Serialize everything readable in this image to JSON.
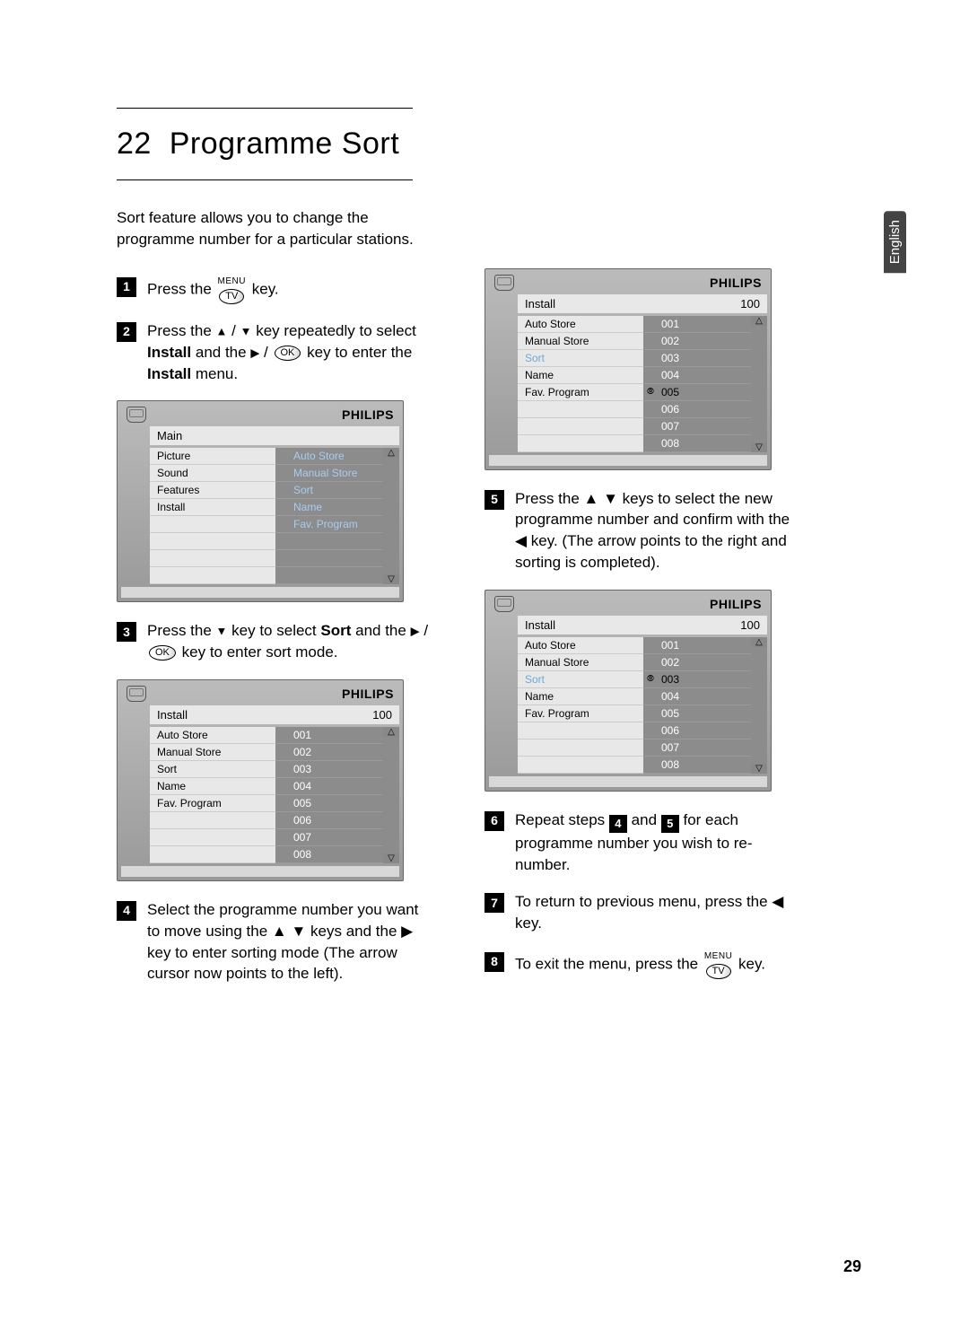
{
  "heading_num": "22",
  "heading_title": "Programme Sort",
  "intro": "Sort feature allows you to change the programme number for a particular stations.",
  "brand": "PHILIPS",
  "lang_tab": "English",
  "page_number": "29",
  "key_menu_label": "MENU",
  "key_tv_label": "TV",
  "key_ok_label": "OK",
  "steps": {
    "s1_a": "Press the",
    "s1_b": "key.",
    "s2_a": "Press the",
    "s2_b": "key repeatedly to select",
    "s2_bold1": "Install",
    "s2_c": "and the",
    "s2_d": "key to enter the",
    "s2_bold2": "Install",
    "s2_e": "menu.",
    "s3_a": "Press the",
    "s3_b": "key to select",
    "s3_bold": "Sort",
    "s3_c": "and the",
    "s3_d": "key to enter sort mode.",
    "s4": "Select the programme number you want to move using the ▲ ▼ keys and the ▶ key to enter sorting mode (The arrow cursor now points to the left).",
    "s5": "Press the ▲ ▼ keys to select the new programme number and confirm with the ◀ key. (The arrow points to the right and sorting is completed).",
    "s6_a": "Repeat steps",
    "s6_b": "and",
    "s6_c": "for each programme number you wish to re-number.",
    "s7": "To return to previous menu, press the ◀ key.",
    "s8_a": "To exit the menu, press the",
    "s8_b": "key."
  },
  "panel_main": {
    "title": "Main",
    "left": [
      "Picture",
      "Sound",
      "Features",
      "Install"
    ],
    "right": [
      "Auto Store",
      "Manual Store",
      "Sort",
      "Name",
      "Fav. Program"
    ]
  },
  "panel_install": {
    "title": "Install",
    "title_right": "100",
    "left": [
      "Auto Store",
      "Manual Store",
      "Sort",
      "Name",
      "Fav. Program"
    ],
    "right": [
      "001",
      "002",
      "003",
      "004",
      "005",
      "006",
      "007",
      "008"
    ]
  }
}
